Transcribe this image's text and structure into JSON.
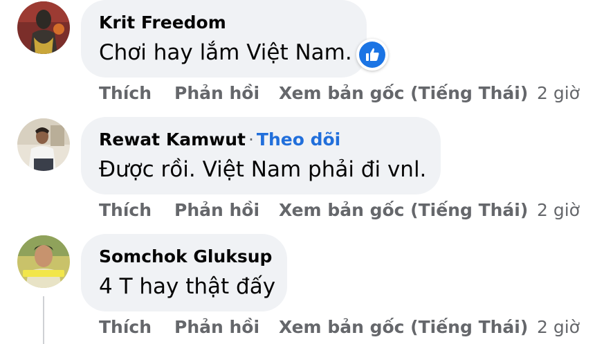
{
  "comments": [
    {
      "author": "Krit Freedom",
      "text": "Chơi hay lắm Việt Nam.",
      "follow_label": "",
      "separator": "",
      "actions": {
        "like": "Thích",
        "reply": "Phản hồi",
        "see_original": "Xem bản gốc (Tiếng Thái)",
        "time": "2 giờ"
      },
      "reaction_icon": "like-icon"
    },
    {
      "author": "Rewat Kamwut",
      "text": "Được rồi. Việt Nam phải đi vnl.",
      "separator": "·",
      "follow_label": "Theo dõi",
      "actions": {
        "like": "Thích",
        "reply": "Phản hồi",
        "see_original": "Xem bản gốc (Tiếng Thái)",
        "time": "2 giờ"
      }
    },
    {
      "author": "Somchok Gluksup",
      "text": "4 T hay thật đấy",
      "follow_label": "",
      "separator": "",
      "actions": {
        "like": "Thích",
        "reply": "Phản hồi",
        "see_original": "Xem bản gốc (Tiếng Thái)",
        "time": "2 giờ"
      }
    }
  ],
  "colors": {
    "bubble": "#f0f2f5",
    "author": "#050505",
    "meta": "#65676b",
    "follow": "#216fdb",
    "like_blue": "#1b74e4"
  }
}
